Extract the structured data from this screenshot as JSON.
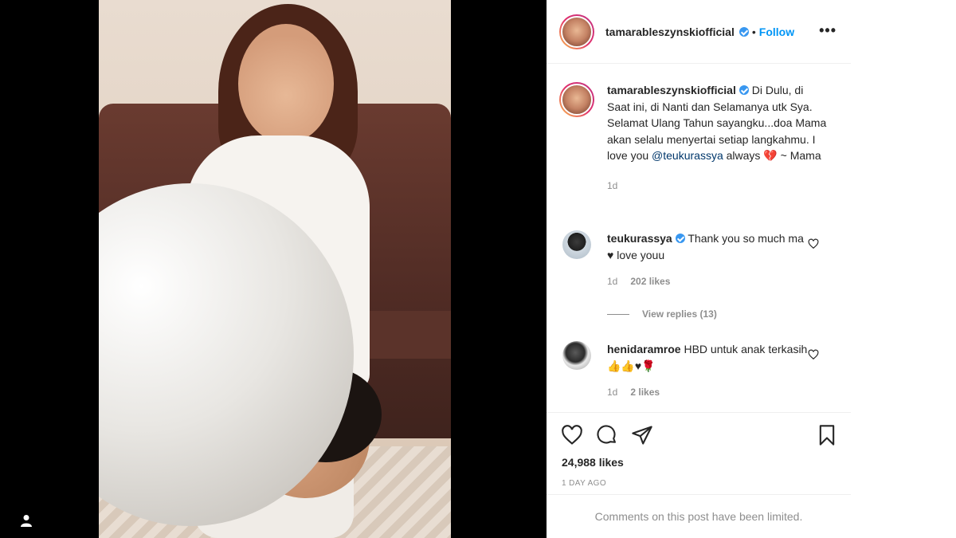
{
  "post": {
    "username": "tamarableszynskiofficial",
    "follow_label": "Follow",
    "separator": "•",
    "more_label": "•••"
  },
  "caption": {
    "username": "tamarableszynskiofficial",
    "text_before_mention": " Di Dulu, di Saat ini, di Nanti dan Selamanya utk Sya. Selamat Ulang Tahun sayangku...doa Mama akan selalu menyertai setiap langkahmu. I love you ",
    "mention": "@teukurassya",
    "text_after_mention": " always 💔 ~ Mama",
    "time": "1d"
  },
  "comments": [
    {
      "username": "teukurassya",
      "verified": true,
      "text": " Thank you so much ma ♥ love youu",
      "time": "1d",
      "likes": "202 likes"
    },
    {
      "username": "henidaramroe",
      "verified": false,
      "text": " HBD untuk anak terkasih 👍👍♥🌹",
      "time": "1d",
      "likes": "2 likes"
    }
  ],
  "view_replies": "View replies (13)",
  "likes": "24,988 likes",
  "time_ago": "1 DAY AGO",
  "limited_notice": "Comments on this post have been limited.",
  "icons": [
    "heart-icon",
    "comment-icon",
    "share-icon",
    "bookmark-icon",
    "more-icon",
    "verified-icon",
    "profile-icon"
  ],
  "colors": {
    "link": "#0095f6",
    "verified": "#3897f0",
    "mention": "#00376b",
    "muted": "#8e8e8e"
  }
}
